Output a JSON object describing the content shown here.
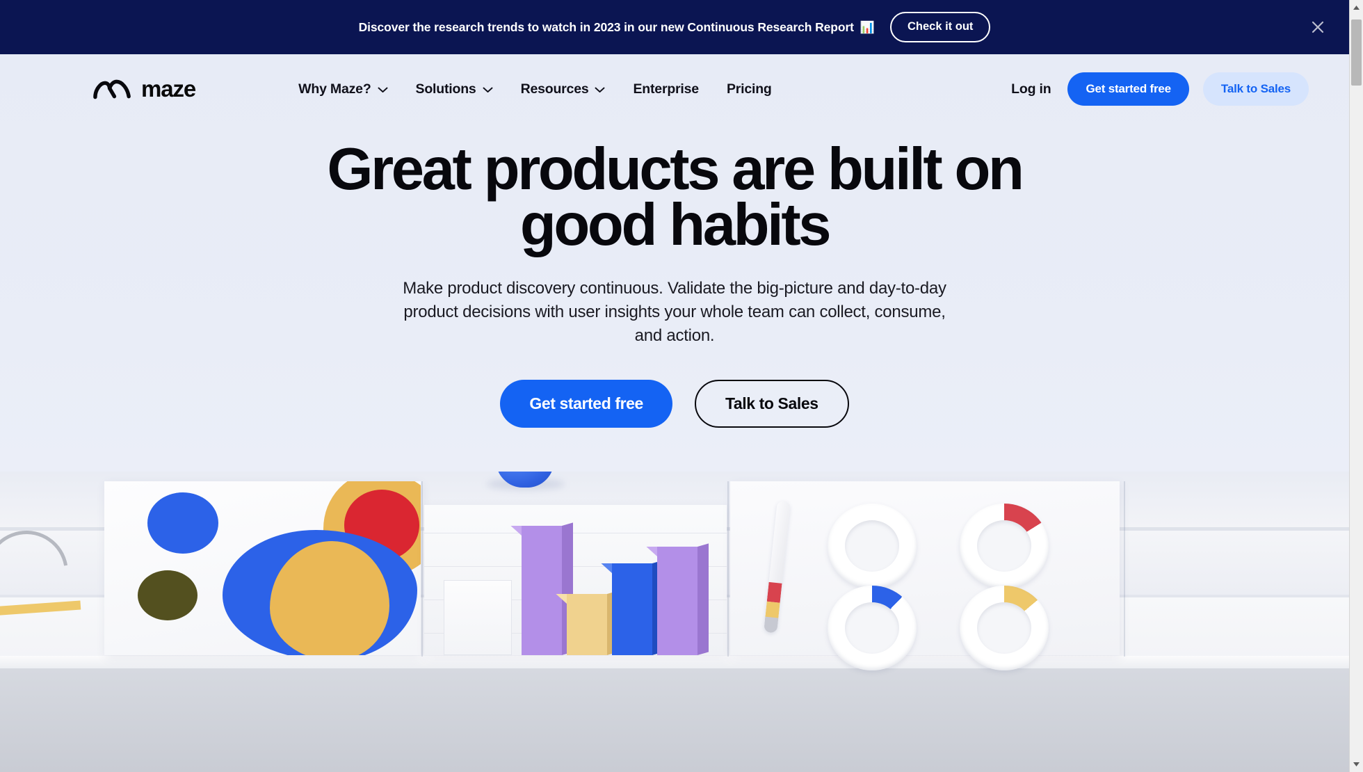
{
  "announcement": {
    "text": "Discover the research trends to watch in 2023 in our new Continuous Research Report",
    "emoji": "📊",
    "cta_label": "Check it out",
    "close_label": "×",
    "background_color": "#0b1552",
    "text_color": "#ffffff"
  },
  "nav": {
    "brand_name": "maze",
    "links": [
      {
        "label": "Why Maze?",
        "has_dropdown": true
      },
      {
        "label": "Solutions",
        "has_dropdown": true
      },
      {
        "label": "Resources",
        "has_dropdown": true
      },
      {
        "label": "Enterprise",
        "has_dropdown": false
      },
      {
        "label": "Pricing",
        "has_dropdown": false
      }
    ],
    "login_label": "Log in",
    "get_started_label": "Get started free",
    "talk_to_sales_label": "Talk to Sales",
    "primary_color": "#1463f3",
    "secondary_bg_color": "#d6e4fd"
  },
  "hero": {
    "title_line_1": "Great products are built on",
    "title_line_2": "good habits",
    "subtitle": "Make product discovery continuous. Validate the big-picture and day-to-day product decisions with user insights your whole team can collect, consume, and action.",
    "primary_cta": "Get started free",
    "secondary_cta": "Talk to Sales"
  },
  "illustration": {
    "description": "3D rendered desk scene with abstract art panel, bar chart blocks, pen and donut ring gauges",
    "colors": {
      "blue": "#2c62e8",
      "yellow": "#eab856",
      "red": "#da2631",
      "olive": "#53501f",
      "purple": "#b38fe8",
      "light_yellow": "#f0d28e"
    }
  },
  "browser": {
    "scroll_up_icon": "▲",
    "scroll_down_icon": "▼"
  }
}
